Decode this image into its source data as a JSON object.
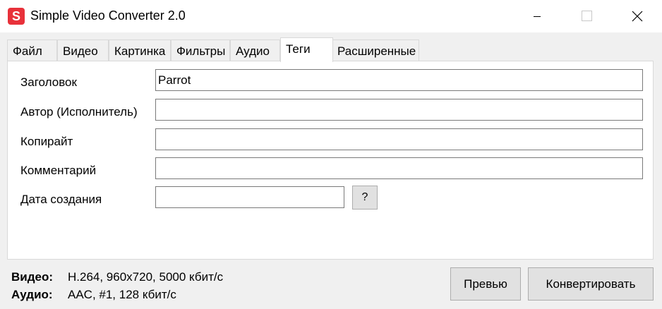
{
  "window": {
    "title": "Simple Video Converter 2.0",
    "app_icon_letter": "S",
    "accent_color": "#e8313a"
  },
  "tabs": [
    {
      "label": "Файл",
      "active": false
    },
    {
      "label": "Видео",
      "active": false
    },
    {
      "label": "Картинка",
      "active": false
    },
    {
      "label": "Фильтры",
      "active": false
    },
    {
      "label": "Аудио",
      "active": false
    },
    {
      "label": "Теги",
      "active": true
    },
    {
      "label": "Расширенные",
      "active": false
    }
  ],
  "form": {
    "title_label": "Заголовок",
    "title_value": "Parrot",
    "author_label": "Автор (Исполнитель)",
    "author_value": "",
    "copyright_label": "Копирайт",
    "copyright_value": "",
    "comment_label": "Комментарий",
    "comment_value": "",
    "date_label": "Дата создания",
    "date_value": "",
    "date_help_button": "?"
  },
  "status": {
    "video_label": "Видео:",
    "video_value": "H.264, 960x720, 5000 кбит/с",
    "audio_label": "Аудио:",
    "audio_value": "AAC, #1, 128 кбит/с"
  },
  "buttons": {
    "preview": "Превью",
    "convert": "Конвертировать"
  },
  "icons": {
    "minimize": "minimize-icon",
    "maximize": "maximize-icon",
    "close": "close-icon"
  }
}
